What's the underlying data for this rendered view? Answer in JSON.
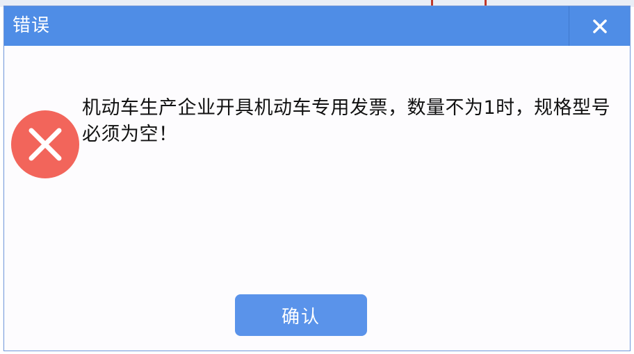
{
  "dialog": {
    "title": "错误",
    "message": "机动车生产企业开具机动车专用发票，数量不为1时，规格型号必须为空！",
    "ok_label": "确认",
    "close_icon": "close-icon",
    "status_icon": "error-icon"
  },
  "colors": {
    "titlebar": "#4f8de6",
    "button": "#5a93ea",
    "error_icon": "#f2655b"
  }
}
